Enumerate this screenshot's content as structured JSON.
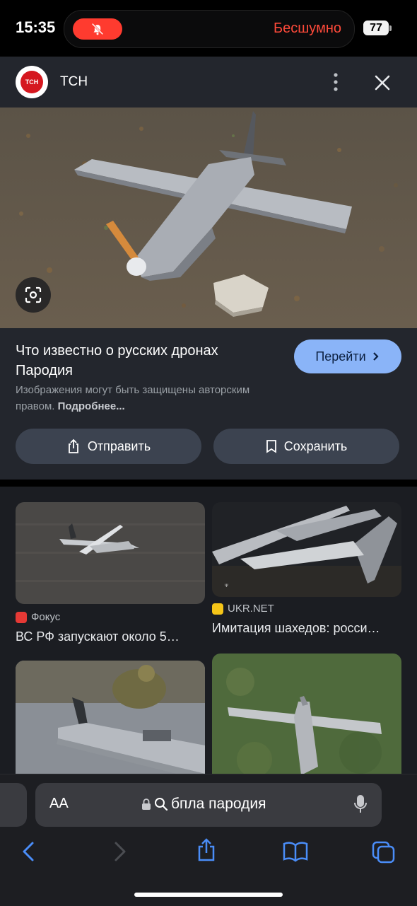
{
  "status_bar": {
    "time": "15:35",
    "mode_label": "Бесшумно",
    "battery": "77"
  },
  "source": {
    "logo_text": "ТСН",
    "name": "ТСН"
  },
  "result": {
    "title": "Что известно о русских дронах Пародия",
    "go_label": "Перейти",
    "copyright_text": "Изображения могут быть защищены авторским правом.",
    "copyright_more": "Подробнее...",
    "share_label": "Отправить",
    "save_label": "Сохранить"
  },
  "related": [
    {
      "source": "Фокус",
      "title": "ВС РФ запускают около 5…",
      "favicon_color": "#e53935"
    },
    {
      "source": "UKR.NET",
      "title": "Имитация шахедов: росси…",
      "favicon_color": "#f5c518"
    },
    {
      "source": "",
      "title": ""
    },
    {
      "source": "",
      "title": ""
    }
  ],
  "address_bar": {
    "text_size_label": "AA",
    "query": "бпла пародия"
  },
  "colors": {
    "accent": "#8ab4f8",
    "silent": "#ff3b2f",
    "panel": "#23262d",
    "background": "#1b1d22"
  },
  "icons": [
    "bell-slash-icon",
    "more-vertical-icon",
    "close-icon",
    "lens-icon",
    "chevron-right-icon",
    "share-icon",
    "bookmark-icon",
    "lock-icon",
    "search-icon",
    "mic-icon",
    "back-icon",
    "forward-icon",
    "book-icon",
    "tabs-icon"
  ]
}
